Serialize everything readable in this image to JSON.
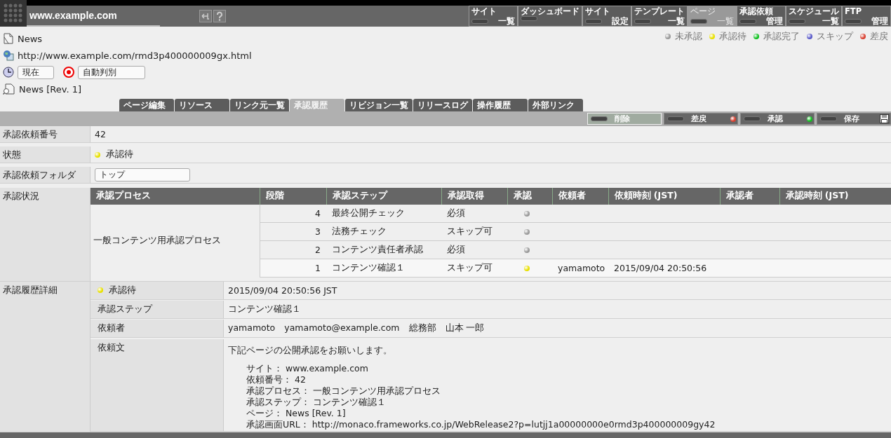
{
  "header": {
    "site": "www.example.com",
    "nav": [
      {
        "top": "サイト",
        "bottom": "一覧",
        "selected": false
      },
      {
        "top": "ダッシュボード",
        "selected": false
      },
      {
        "top": "サイト",
        "bottom": "設定",
        "selected": false
      },
      {
        "top": "テンプレート",
        "bottom": "一覧",
        "selected": false
      },
      {
        "top": "ページ",
        "bottom": "一覧",
        "selected": true
      },
      {
        "top": "承認依頼",
        "bottom": "管理",
        "selected": false
      },
      {
        "top": "スケジュール",
        "bottom": "一覧",
        "selected": false
      },
      {
        "top": "FTP",
        "bottom": "管理",
        "selected": false
      }
    ]
  },
  "page": {
    "name": "News",
    "url": "http://www.example.com/rmd3p400000009gx.html",
    "time_select": "現在",
    "mode_select": "自動判別",
    "revision": "News [Rev. 1]"
  },
  "legend": [
    {
      "label": "未承認",
      "color": "#999999"
    },
    {
      "label": "承認待",
      "color": "#e8e000"
    },
    {
      "label": "承認完了",
      "color": "#10c020"
    },
    {
      "label": "スキップ",
      "color": "#5a5ac8"
    },
    {
      "label": "差戻",
      "color": "#d84030"
    }
  ],
  "tabs": [
    {
      "label": "ページ編集",
      "selected": false
    },
    {
      "label": "リソース",
      "selected": false
    },
    {
      "label": "リンク元一覧",
      "selected": false
    },
    {
      "label": "承認履歴",
      "selected": true
    },
    {
      "label": "リビジョン一覧",
      "selected": false
    },
    {
      "label": "リリースログ",
      "selected": false
    },
    {
      "label": "操作履歴",
      "selected": false
    },
    {
      "label": "外部リンク",
      "selected": false
    }
  ],
  "actions": [
    {
      "label": "削除",
      "kind": "plain",
      "highlighted": true
    },
    {
      "label": "差戻",
      "kind": "red",
      "highlighted": false
    },
    {
      "label": "承認",
      "kind": "green",
      "highlighted": false
    },
    {
      "label": "保存",
      "kind": "save",
      "highlighted": false
    }
  ],
  "request": {
    "number_label": "承認依頼番号",
    "number": "42",
    "status_label": "状態",
    "status": "承認待",
    "color": "#e8e000",
    "folder_label": "承認依頼フォルダ",
    "folder": "トップ",
    "progress_label": "承認状況"
  },
  "approval_table": {
    "columns": [
      "承認プロセス",
      "段階",
      "承認ステップ",
      "承認取得",
      "承認",
      "依頼者",
      "依頼時刻 (JST)",
      "承認者",
      "承認時刻 (JST)"
    ],
    "process": "一般コンテンツ用承認プロセス",
    "rows": [
      {
        "stage": "4",
        "step": "最終公開チェック",
        "requirement": "必須",
        "color": "#999999"
      },
      {
        "stage": "3",
        "step": "法務チェック",
        "requirement": "スキップ可",
        "color": "#999999"
      },
      {
        "stage": "2",
        "step": "コンテンツ責任者承認",
        "requirement": "必須",
        "color": "#999999"
      },
      {
        "stage": "1",
        "step": "コンテンツ確認１",
        "requirement": "スキップ可",
        "color": "#e8e000",
        "requester": "yamamoto",
        "requested_at": "2015/09/04 20:50:56"
      }
    ]
  },
  "history": {
    "label": "承認履歴詳細",
    "status": "承認待",
    "color": "#e8e000",
    "time": "2015/09/04 20:50:56 JST",
    "fields": [
      {
        "label": "承認ステップ",
        "value": "コンテンツ確認１"
      },
      {
        "label": "依頼者",
        "value": "yamamoto　yamamoto@example.com　総務部　山本 一郎"
      }
    ],
    "message_label": "依頼文",
    "message_intro": "下記ページの公開承認をお願いします。",
    "message_lines": [
      "サイト： www.example.com",
      "依頼番号： 42",
      "承認プロセス： 一般コンテンツ用承認プロセス",
      "承認ステップ： コンテンツ確認１",
      "ページ： News [Rev. 1]",
      "承認画面URL： http://monaco.frameworks.co.jp/WebRelease2?p=lutjj1a00000000e0rmd3p400000009gy42"
    ]
  }
}
